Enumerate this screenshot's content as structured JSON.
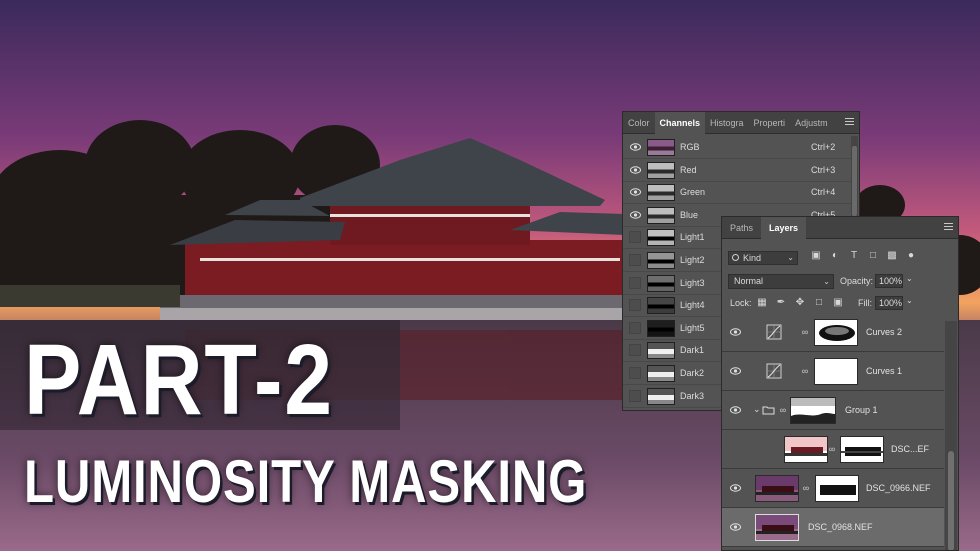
{
  "title": {
    "main": "PART-2",
    "sub": "LUMINOSITY MASKING"
  },
  "colors": {
    "panel_bg": "#535353",
    "tabbar_bg": "#424242",
    "sky_top": "#3b2a5c",
    "sky_mid": "#b04a7a",
    "sky_horizon": "#f3a35f",
    "temple_red": "#7a1c22"
  },
  "channels_panel": {
    "tabs": [
      {
        "label": "Color"
      },
      {
        "label": "Channels"
      },
      {
        "label": "Histogra"
      },
      {
        "label": "Properti"
      },
      {
        "label": "Adjustm"
      }
    ],
    "menu_icon": "hamburger-icon",
    "rows": [
      {
        "name": "RGB",
        "shortcut": "Ctrl+2",
        "visible": true
      },
      {
        "name": "Red",
        "shortcut": "Ctrl+3",
        "visible": true
      },
      {
        "name": "Green",
        "shortcut": "Ctrl+4",
        "visible": true
      },
      {
        "name": "Blue",
        "shortcut": "Ctrl+5",
        "visible": true
      },
      {
        "name": "Light1",
        "shortcut": "",
        "visible": false
      },
      {
        "name": "Light2",
        "shortcut": "",
        "visible": false
      },
      {
        "name": "Light3",
        "shortcut": "",
        "visible": false
      },
      {
        "name": "Light4",
        "shortcut": "",
        "visible": false
      },
      {
        "name": "Light5",
        "shortcut": "",
        "visible": false
      },
      {
        "name": "Dark1",
        "shortcut": "",
        "visible": false
      },
      {
        "name": "Dark2",
        "shortcut": "",
        "visible": false
      },
      {
        "name": "Dark3",
        "shortcut": "",
        "visible": false
      }
    ]
  },
  "layers_panel": {
    "tabs": [
      {
        "label": "Paths"
      },
      {
        "label": "Layers"
      }
    ],
    "filter_kind": "Kind",
    "blend_mode": "Normal",
    "opacity_label": "Opacity:",
    "opacity_value": "100%",
    "lock_label": "Lock:",
    "fill_label": "Fill:",
    "fill_value": "100%",
    "layers": [
      {
        "name": "Curves 2",
        "kind": "adjustment"
      },
      {
        "name": "Curves 1",
        "kind": "adjustment"
      },
      {
        "name": "Group 1",
        "kind": "group"
      },
      {
        "name": "DSC...EF",
        "kind": "masked-image"
      },
      {
        "name": "DSC_0966.NEF",
        "kind": "masked-image"
      },
      {
        "name": "DSC_0968.NEF",
        "kind": "image"
      }
    ]
  }
}
